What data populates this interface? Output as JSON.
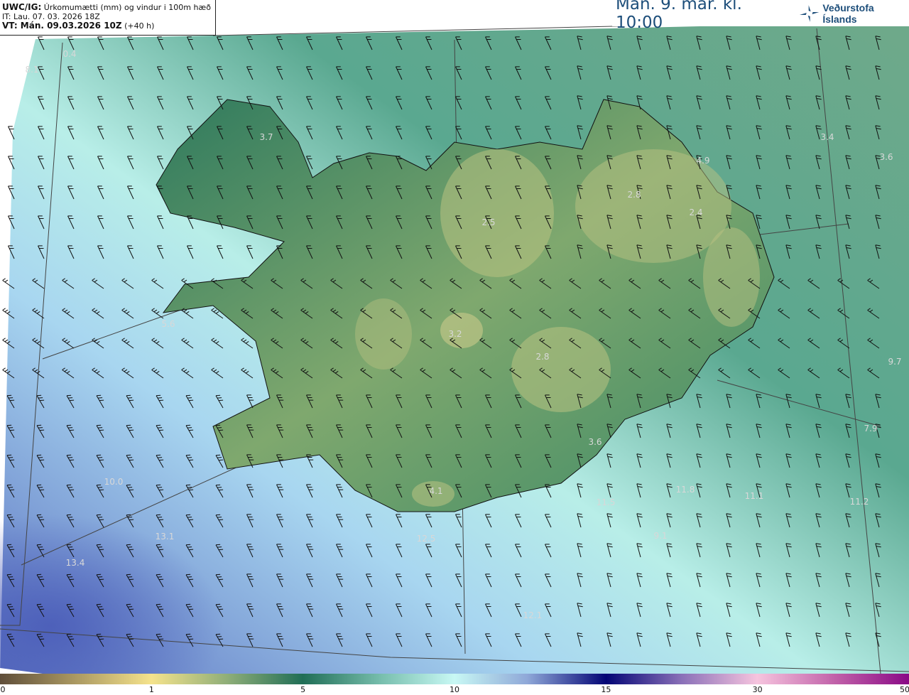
{
  "header": {
    "product_code": "UWC/IG:",
    "product_desc": "Úrkomumætti (mm) og vindur i 100m hæð",
    "initial_time": "IT: Lau. 07. 03. 2026 18Z",
    "valid_time_label": "VT: Mán. 09.03.2026 10Z",
    "lead_time": "(+40 h)"
  },
  "title": {
    "date": "Mán. 9. mar. kl. 10:00",
    "logo_text": "Veðurstofa Íslands",
    "logo_color": "#1d4e7a"
  },
  "map": {
    "labels": [
      "0.4",
      "8.1",
      "3.7",
      "3.4",
      "3.6",
      "4.9",
      "2.8",
      "2.4",
      "2.5",
      "5.6",
      "3.2",
      "2.8",
      "9.7",
      "7.9",
      "3.6",
      "4.1",
      "10.0",
      "11.8",
      "11.1",
      "11.5",
      "11.2",
      "9.1",
      "13.1",
      "12.5",
      "13.4",
      "12.1"
    ]
  },
  "colorbar": {
    "ticks": [
      "0",
      "1",
      "5",
      "10",
      "15",
      "30",
      "50"
    ],
    "colors": [
      "#5f4e3a",
      "#f5e38c",
      "#206e56",
      "#c8f8f4",
      "#030575",
      "#f6c4de",
      "#8a0a86"
    ]
  }
}
